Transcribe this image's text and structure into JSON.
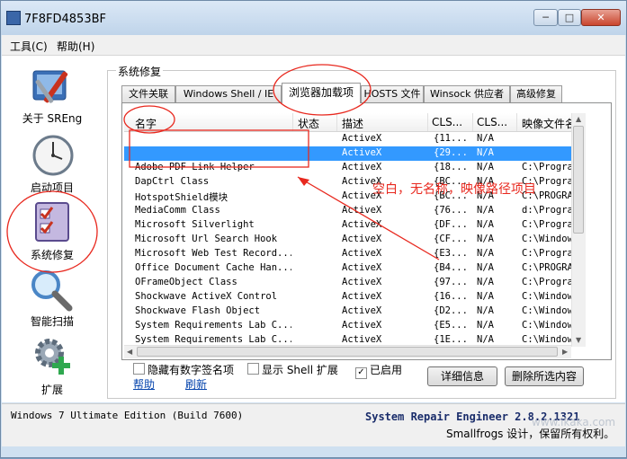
{
  "window": {
    "title": "7F8FD4853BF",
    "min_glyph": "─",
    "max_glyph": "□",
    "close_glyph": "✕"
  },
  "menu": [
    {
      "label": "工具(C)"
    },
    {
      "label": "帮助(H)"
    }
  ],
  "nav": [
    {
      "label": "关于 SREng",
      "icon": "about-tools-icon"
    },
    {
      "label": "启动项目",
      "icon": "clock-icon"
    },
    {
      "label": "系统修复",
      "icon": "checklist-icon"
    },
    {
      "label": "智能扫描",
      "icon": "magnifier-icon"
    },
    {
      "label": "扩展",
      "icon": "gear-plus-icon"
    }
  ],
  "section_title": "系统修复",
  "tabs": [
    {
      "label": "文件关联"
    },
    {
      "label": "Windows Shell / IE"
    },
    {
      "label": "浏览器加载项",
      "active": true
    },
    {
      "label": "HOSTS 文件"
    },
    {
      "label": "Winsock 供应者"
    },
    {
      "label": "高级修复"
    }
  ],
  "columns": [
    "名字",
    "状态",
    "描述",
    "CLS...",
    "CLS...",
    "映像文件名"
  ],
  "rows": [
    [
      "",
      "",
      "ActiveX",
      "{11...",
      "N/A",
      ""
    ],
    [
      "",
      "",
      "ActiveX",
      "{29...",
      "N/A",
      ""
    ],
    [
      "Adobe PDF Link Helper",
      "",
      "ActiveX",
      "{18...",
      "N/A",
      "C:\\Progra"
    ],
    [
      "DapCtrl Class",
      "",
      "ActiveX",
      "{BC...",
      "N/A",
      "C:\\Progra"
    ],
    [
      "HotspotShield模块",
      "",
      "ActiveX",
      "{BC...",
      "N/A",
      "C:\\PROGRA"
    ],
    [
      "MediaComm Class",
      "",
      "ActiveX",
      "{76...",
      "N/A",
      "d:\\Progra"
    ],
    [
      "Microsoft Silverlight",
      "",
      "ActiveX",
      "{DF...",
      "N/A",
      "C:\\Progra"
    ],
    [
      "Microsoft Url Search Hook",
      "",
      "ActiveX",
      "{CF...",
      "N/A",
      "C:\\Window"
    ],
    [
      "Microsoft Web Test Record...",
      "",
      "ActiveX",
      "{E3...",
      "N/A",
      "C:\\Progra"
    ],
    [
      "Office Document Cache Han...",
      "",
      "ActiveX",
      "{B4...",
      "N/A",
      "C:\\PROGRA"
    ],
    [
      "OFrameObject Class",
      "",
      "ActiveX",
      "{97...",
      "N/A",
      "C:\\Progra"
    ],
    [
      "Shockwave ActiveX Control",
      "",
      "ActiveX",
      "{16...",
      "N/A",
      "C:\\Window"
    ],
    [
      "Shockwave Flash Object",
      "",
      "ActiveX",
      "{D2...",
      "N/A",
      "C:\\Window"
    ],
    [
      "System Requirements Lab C...",
      "",
      "ActiveX",
      "{E5...",
      "N/A",
      "C:\\Window"
    ],
    [
      "System Requirements Lab C...",
      "",
      "ActiveX",
      "{1E...",
      "N/A",
      "C:\\Window"
    ]
  ],
  "selected_row": 1,
  "options": [
    {
      "label": "隐藏有数字签名项",
      "checked": false
    },
    {
      "label": "显示 Shell 扩展",
      "checked": false
    },
    {
      "label": "已启用",
      "checked": true
    }
  ],
  "buttons": {
    "details": "详细信息",
    "delete": "删除所选内容"
  },
  "links": {
    "help": "帮助",
    "refresh": "刷新"
  },
  "annotation_note": "空白，无名称，映像路径项目",
  "status": {
    "os": "Windows 7 Ultimate Edition  (Build 7600)",
    "product": "System Repair Engineer  2.8.2.1321",
    "copyright": "Smallfrogs 设计，保留所有权利。",
    "watermark": "www.ikaka.com"
  },
  "colors": {
    "selection": "#3399ff",
    "annotation": "#e8281e",
    "brand": "#1a2d6b"
  }
}
